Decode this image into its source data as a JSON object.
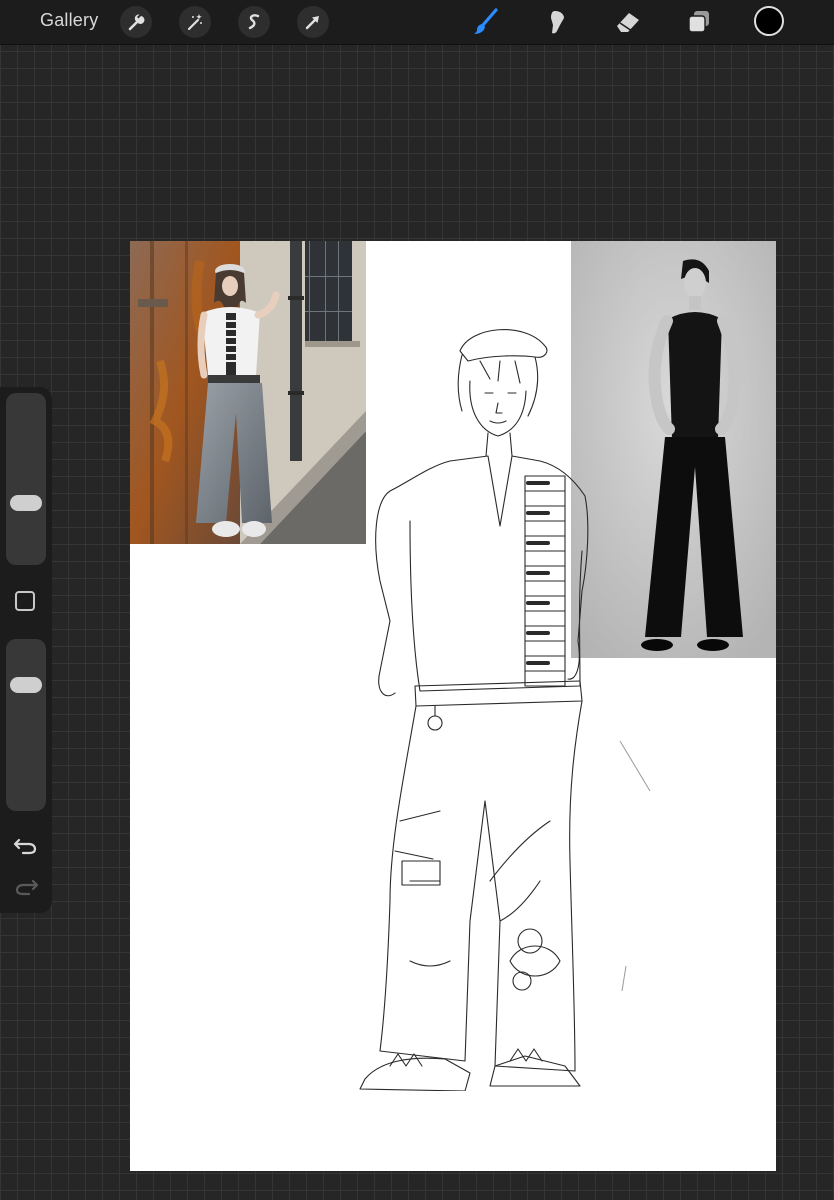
{
  "toolbar": {
    "gallery_label": "Gallery",
    "left_tools": [
      "wrench-icon",
      "magic-wand-icon",
      "selection-icon",
      "transform-arrow-icon"
    ],
    "right_tools": [
      "brush-icon",
      "smudge-icon",
      "eraser-icon",
      "layers-icon"
    ],
    "active_tool": "brush",
    "accent_color": "#2a8cff",
    "current_color": "#000000"
  },
  "sidebar": {
    "brush_size_level": 0.34,
    "opacity_level": 0.77,
    "icons": [
      "modify-square-icon",
      "undo-icon",
      "redo-icon"
    ]
  },
  "canvas": {
    "background": "#ffffff",
    "images": [
      "reference-photo-left",
      "reference-photo-right",
      "fashion-figure-sketch"
    ]
  }
}
